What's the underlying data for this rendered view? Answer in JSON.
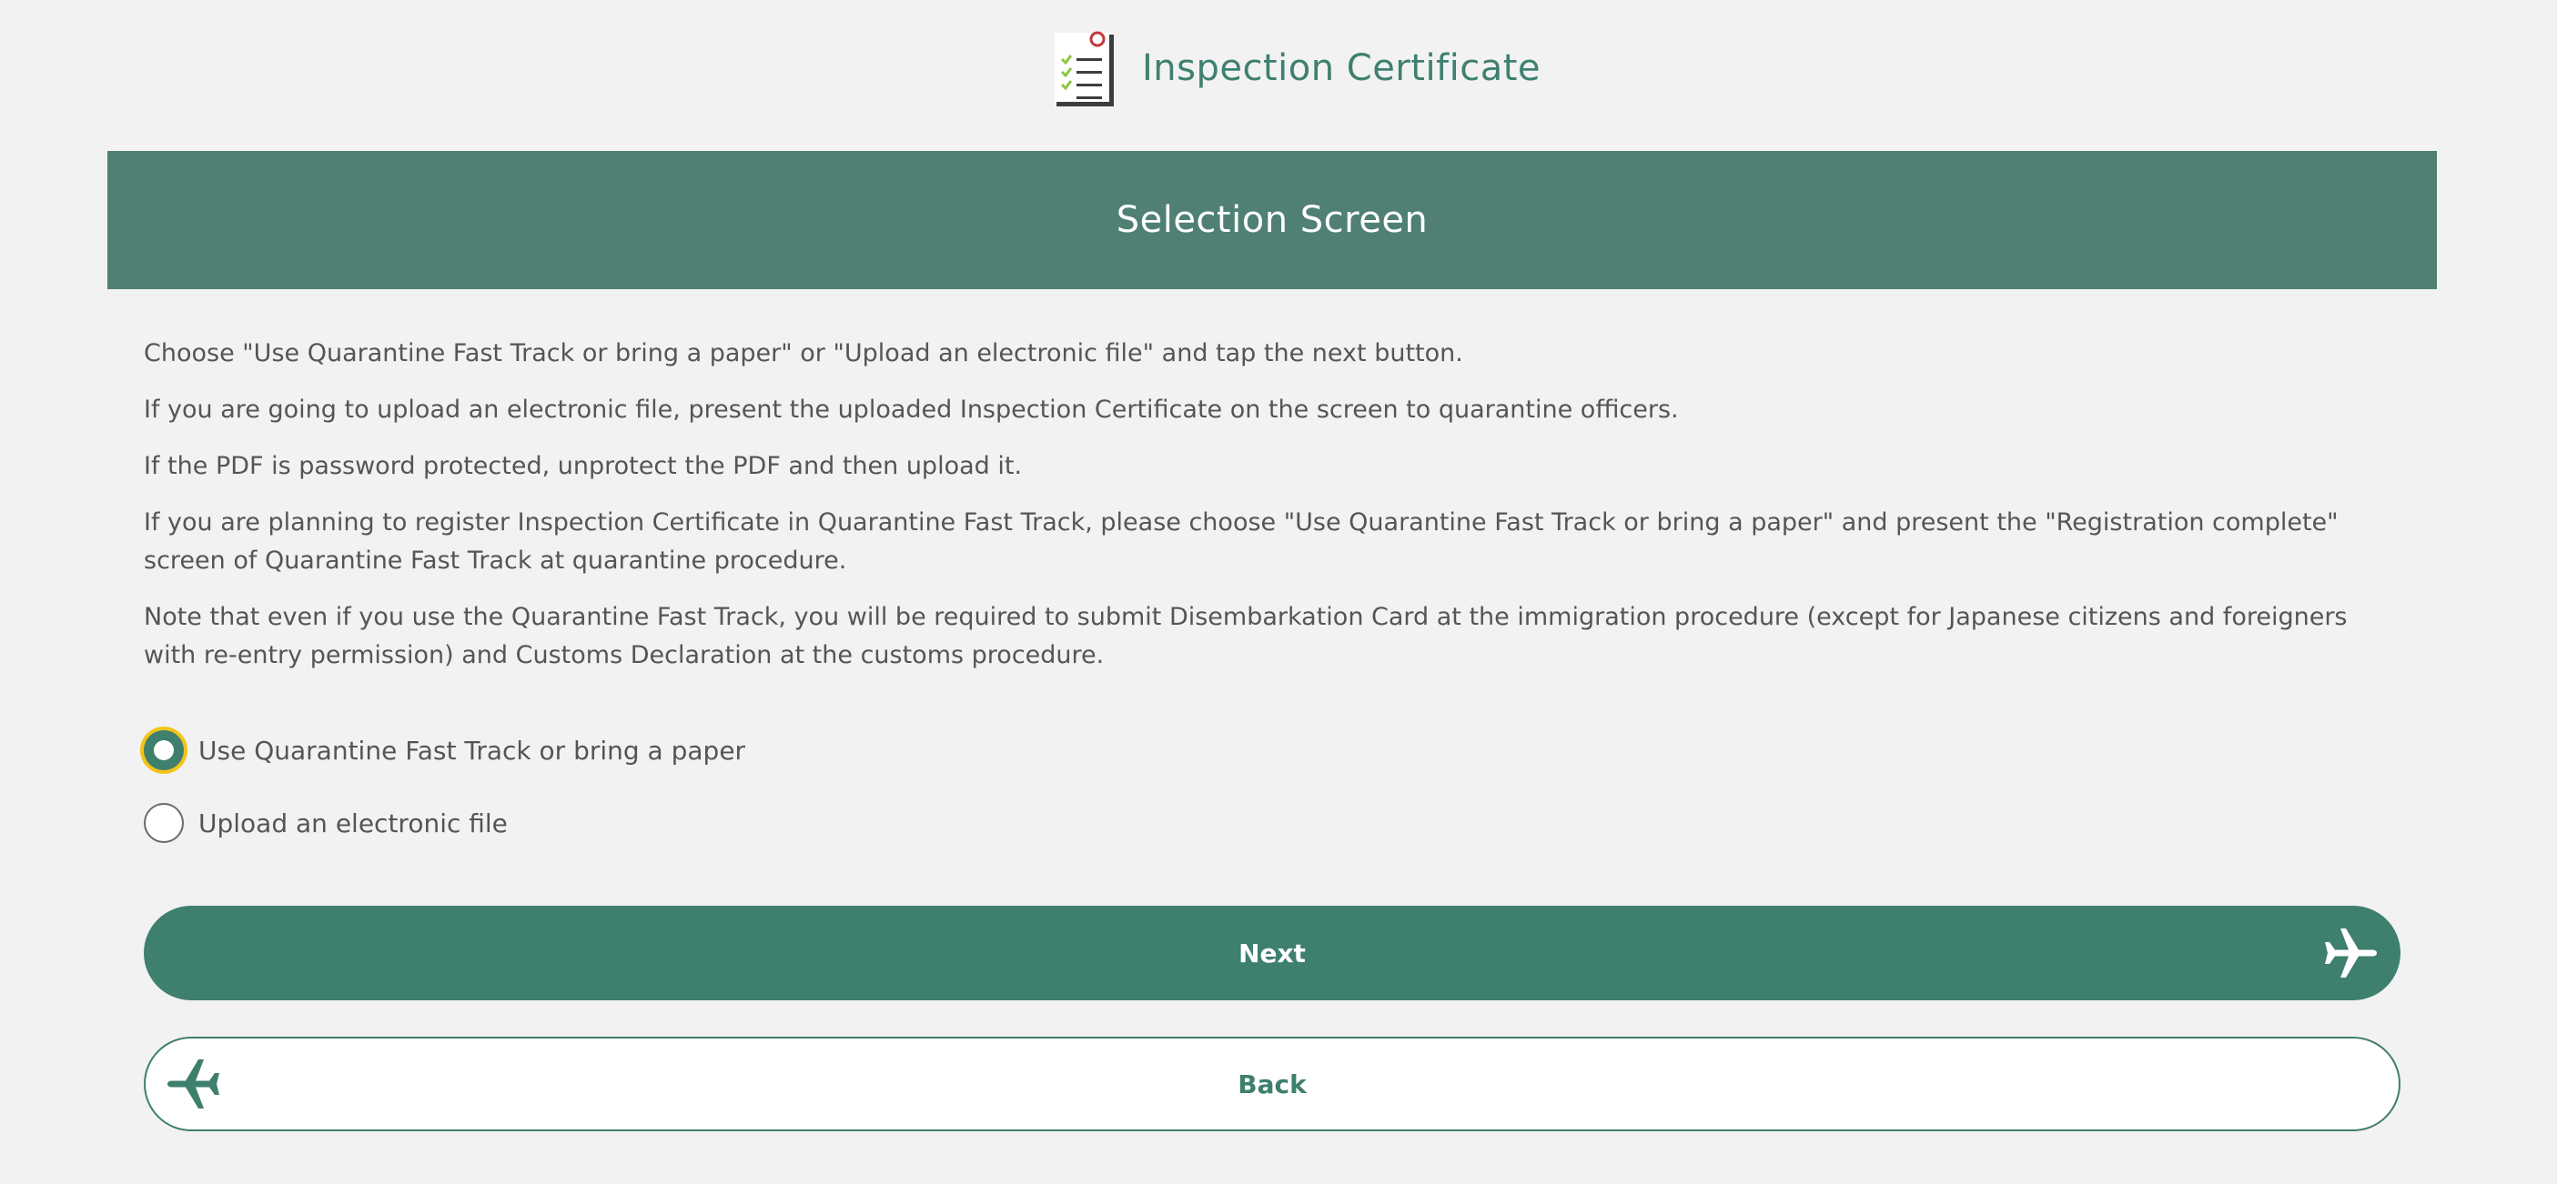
{
  "header": {
    "title": "Inspection Certificate",
    "icon": "checklist-icon"
  },
  "banner": {
    "title": "Selection Screen"
  },
  "instructions": [
    "Choose \"Use Quarantine Fast Track or bring a paper\" or \"Upload an electronic file\" and tap the next button.",
    "If you are going to upload an electronic file, present the uploaded Inspection Certificate on the screen to quarantine officers.",
    "If the PDF is password protected, unprotect the PDF and then upload it.",
    "If you are planning to register Inspection Certificate in Quarantine Fast Track, please choose \"Use Quarantine Fast Track or bring a paper\" and present the \"Registration complete\" screen of Quarantine Fast Track at quarantine procedure.",
    "Note that even if you use the Quarantine Fast Track, you will be required to submit Disembarkation Card at the immigration procedure (except for Japanese citizens and foreigners with re-entry permission) and Customs Declaration at the customs procedure."
  ],
  "options": [
    {
      "label": "Use Quarantine Fast Track or bring a paper",
      "selected": true
    },
    {
      "label": "Upload an electronic file",
      "selected": false
    }
  ],
  "buttons": {
    "next_label": "Next",
    "back_label": "Back"
  },
  "colors": {
    "background": "#f2f2f2",
    "brand_green": "#3e7f6e",
    "banner_green": "#4f8073",
    "focus_ring": "#f2c418",
    "text": "#555555"
  }
}
